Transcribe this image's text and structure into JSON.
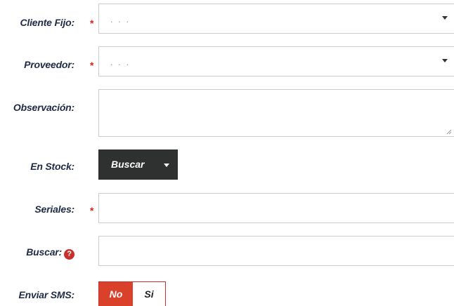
{
  "form": {
    "cliente_fijo": {
      "label": "Cliente Fijo:",
      "required_mark": "*",
      "selected": ". . ."
    },
    "proveedor": {
      "label": "Proveedor:",
      "required_mark": "*",
      "selected": ". . ."
    },
    "observacion": {
      "label": "Observación:",
      "value": ""
    },
    "en_stock": {
      "label": "En Stock:",
      "button_label": "Buscar"
    },
    "seriales": {
      "label": "Seriales:",
      "required_mark": "*",
      "value": ""
    },
    "buscar": {
      "label": "Buscar:",
      "help_icon": "question-circle-icon",
      "value": ""
    },
    "enviar_sms": {
      "label": "Enviar SMS:",
      "options": [
        "No",
        "Si"
      ],
      "selected": "No"
    }
  },
  "colors": {
    "label_text": "#1f2b45",
    "required": "#e02020",
    "dark_button": "#2f3030",
    "toggle_active": "#d9412b",
    "field_border": "#cccccc"
  }
}
